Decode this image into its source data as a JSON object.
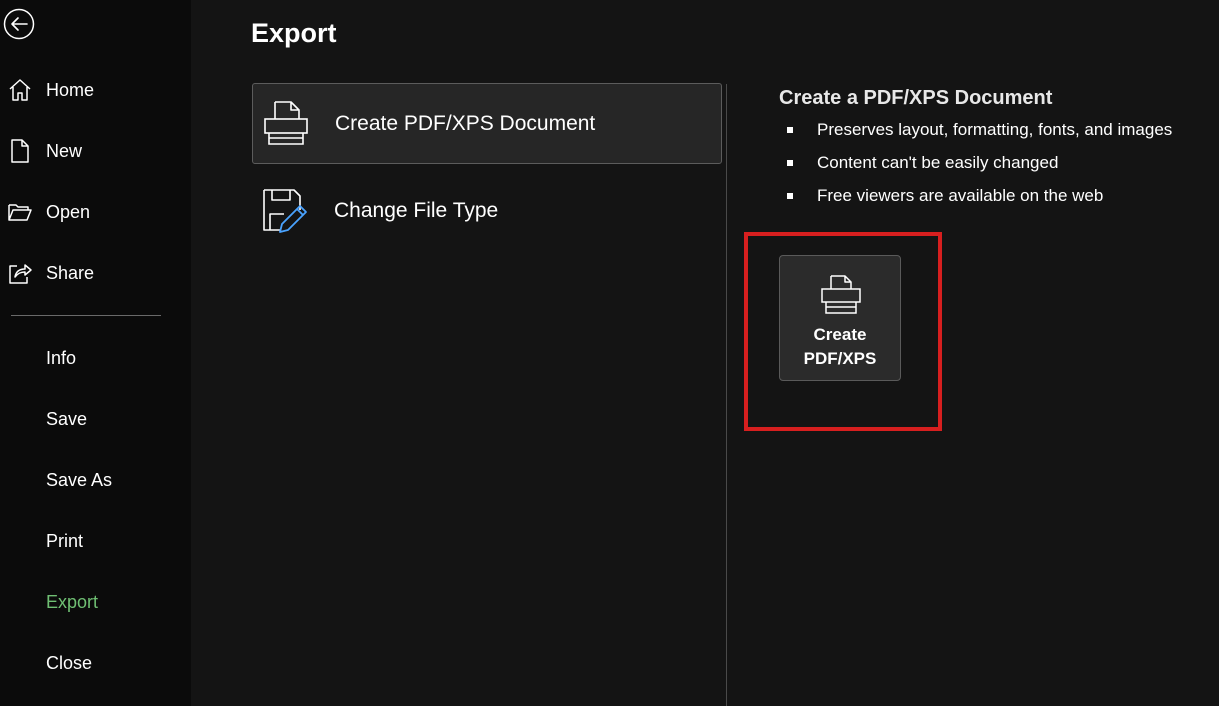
{
  "sidebar": {
    "back_label": "",
    "items": [
      {
        "label": "Home",
        "icon": "home-icon"
      },
      {
        "label": "New",
        "icon": "new-document-icon"
      },
      {
        "label": "Open",
        "icon": "open-folder-icon"
      },
      {
        "label": "Share",
        "icon": "share-icon"
      },
      {
        "label": "Info"
      },
      {
        "label": "Save"
      },
      {
        "label": "Save As"
      },
      {
        "label": "Print"
      },
      {
        "label": "Export"
      },
      {
        "label": "Close"
      }
    ],
    "active_item": "Export",
    "active_color": "#6fbf73"
  },
  "main": {
    "title": "Export",
    "options": [
      {
        "label": "Create PDF/XPS Document",
        "icon": "pdf-document-icon",
        "selected": true
      },
      {
        "label": "Change File Type",
        "icon": "change-file-type-icon",
        "selected": false
      }
    ]
  },
  "detail": {
    "title": "Create a PDF/XPS Document",
    "bullets": [
      "Preserves layout, formatting, fonts, and images",
      "Content can't be easily changed",
      "Free viewers are available on the web"
    ],
    "button": {
      "line1": "Create",
      "line2": "PDF/XPS",
      "icon": "pdf-document-icon"
    },
    "highlight_color": "#d71f1f"
  }
}
